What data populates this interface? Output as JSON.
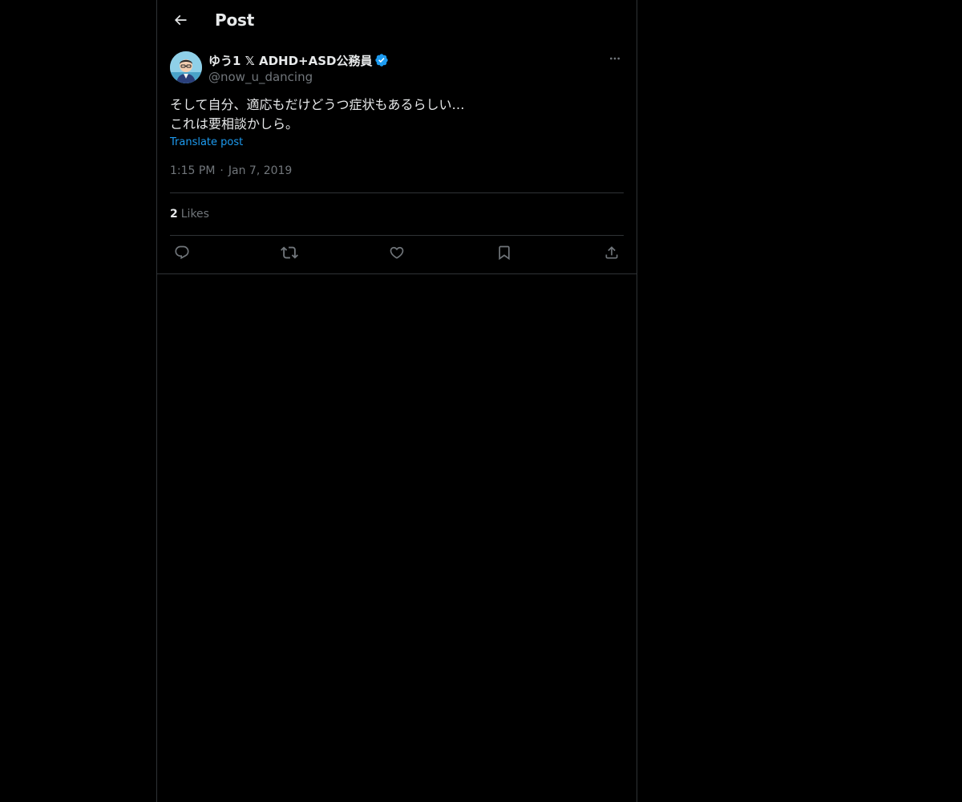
{
  "header": {
    "back_icon": "arrow-left-icon",
    "title": "Post"
  },
  "post": {
    "author": {
      "avatar_icon": "avatar-portrait",
      "display_name": "ゆう1 𝕏 ADHD+ASD公務員",
      "verified_icon": "verified-badge-icon",
      "handle": "@now_u_dancing"
    },
    "more_icon": "more-horizontal-icon",
    "text_lines": [
      "そして自分、適応もだけどうつ症状もあるらしい…",
      "これは要相談かしら。"
    ],
    "translate_label": "Translate post",
    "time": "1:15 PM",
    "separator": "·",
    "date": "Jan 7, 2019",
    "likes": {
      "count": "2",
      "label": "Likes"
    },
    "actions": [
      {
        "icon": "reply-icon"
      },
      {
        "icon": "repost-icon"
      },
      {
        "icon": "like-icon"
      },
      {
        "icon": "bookmark-icon"
      },
      {
        "icon": "share-icon"
      }
    ]
  },
  "colors": {
    "background": "#000000",
    "text_primary": "#e7e9ea",
    "text_secondary": "#71767b",
    "accent": "#1d9bf0",
    "border": "#2f3336"
  }
}
